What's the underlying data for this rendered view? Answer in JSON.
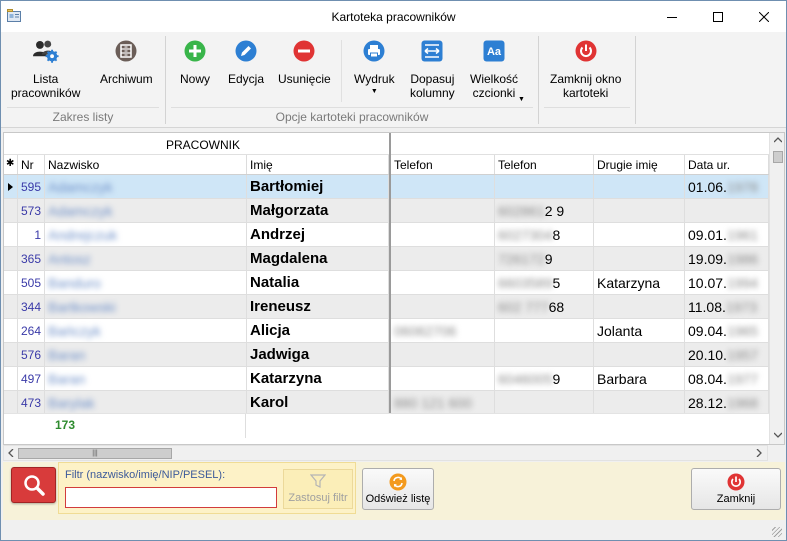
{
  "window": {
    "title": "Kartoteka pracowników"
  },
  "ribbon": {
    "buttons": [
      {
        "id": "lista",
        "label": "Lista\npracowników",
        "icon": "users-gear-icon"
      },
      {
        "id": "archiwum",
        "label": "Archiwum",
        "icon": "archive-icon"
      },
      {
        "id": "nowy",
        "label": "Nowy",
        "icon": "plus-icon"
      },
      {
        "id": "edycja",
        "label": "Edycja",
        "icon": "pencil-icon"
      },
      {
        "id": "usuniecie",
        "label": "Usunięcie",
        "icon": "minus-icon"
      },
      {
        "id": "wydruk",
        "label": "Wydruk",
        "icon": "printer-icon"
      },
      {
        "id": "dopasuj",
        "label": "Dopasuj\nkolumny",
        "icon": "fit-columns-icon"
      },
      {
        "id": "wielkosc",
        "label": "Wielkość\nczcionki",
        "icon": "font-size-icon"
      },
      {
        "id": "zamknij_okno",
        "label": "Zamknij okno\nkartoteki",
        "icon": "power-icon"
      }
    ],
    "groups": {
      "zakres": "Zakres listy",
      "opcje": "Opcje kartoteki pracowników"
    },
    "icon_colors": {
      "green": "#39b54a",
      "blue": "#2d7fd3",
      "red": "#e03434"
    }
  },
  "grid": {
    "band_title": "PRACOWNIK",
    "columns": [
      "Nr",
      "Nazwisko",
      "Imię",
      "Telefon",
      "Telefon",
      "Drugie imię",
      "Data ur."
    ],
    "rows": [
      {
        "nr": "595",
        "nazwisko": "Adamczyk",
        "imie": "Bartłomiej",
        "tel1": "",
        "tel2": "",
        "drugie": "",
        "data": "01.06.",
        "data_blur": "1978",
        "selected": true
      },
      {
        "nr": "573",
        "nazwisko": "Adamczyk",
        "imie": "Małgorzata",
        "tel1": "",
        "tel2_blur": "602861",
        "tel2": "2 9",
        "drugie": "",
        "data": "",
        "data_blur": ""
      },
      {
        "nr": "1",
        "nazwisko": "Andrejczuk",
        "imie": "Andrzej",
        "tel1": "",
        "tel2_blur": "6027304",
        "tel2": "8",
        "drugie": "",
        "data": "09.01.",
        "data_blur": "1961"
      },
      {
        "nr": "365",
        "nazwisko": "Antosz",
        "imie": "Magdalena",
        "tel1": "",
        "tel2_blur": "726172",
        "tel2": "9",
        "drugie": "",
        "data": "19.09.",
        "data_blur": "1986"
      },
      {
        "nr": "505",
        "nazwisko": "Banduro",
        "imie": "Natalia",
        "tel1": "",
        "tel2_blur": "6603589",
        "tel2": "5",
        "drugie": "Katarzyna",
        "data": "10.07.",
        "data_blur": "1994"
      },
      {
        "nr": "344",
        "nazwisko": "Bartkowski",
        "imie": "Ireneusz",
        "tel1": "",
        "tel2_blur": "602 777",
        "tel2": "68",
        "drugie": "",
        "data": "11.08.",
        "data_blur": "1973"
      },
      {
        "nr": "264",
        "nazwisko": "Bańczyk",
        "imie": "Alicja",
        "tel1": "",
        "tel1_blur": "06062706",
        "tel2": "",
        "drugie": "Jolanta",
        "data": "09.04.",
        "data_blur": "1965"
      },
      {
        "nr": "576",
        "nazwisko": "Baran",
        "imie": "Jadwiga",
        "tel1": "",
        "tel2": "",
        "drugie": "",
        "data": "20.10.",
        "data_blur": "1957"
      },
      {
        "nr": "497",
        "nazwisko": "Baran",
        "imie": "Katarzyna",
        "tel1": "",
        "tel2_blur": "6046005",
        "tel2": "9",
        "drugie": "Barbara",
        "data": "08.04.",
        "data_blur": "1977"
      },
      {
        "nr": "473",
        "nazwisko": "Barylak",
        "imie": "Karol",
        "tel1": "",
        "tel1_blur": "880 121 600",
        "tel2": "",
        "drugie": "",
        "data": "28.12.",
        "data_blur": "1968"
      }
    ],
    "count": "173"
  },
  "filter": {
    "label": "Filtr (nazwisko/imię/NIP/PESEL):",
    "value": "",
    "apply_label": "Zastosuj filtr",
    "refresh_label": "Odśwież listę",
    "close_label": "Zamknij"
  }
}
